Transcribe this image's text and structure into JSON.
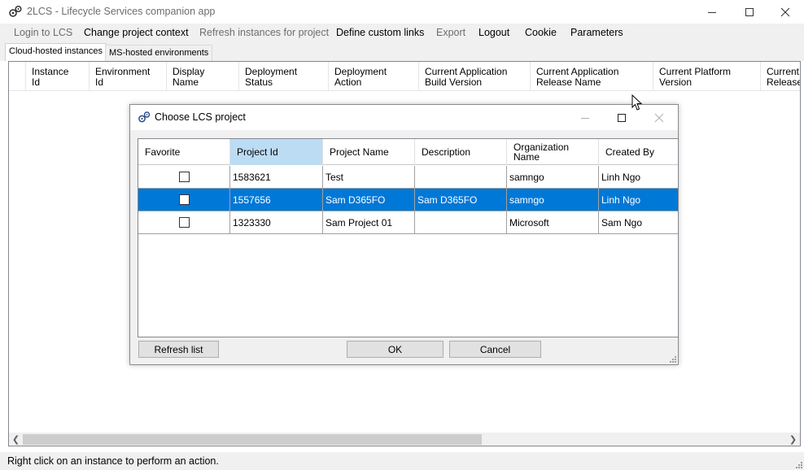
{
  "window": {
    "title": "2LCS - Lifecycle Services companion app"
  },
  "menu": [
    {
      "label": "Login to LCS",
      "enabled": false
    },
    {
      "label": "Change project context",
      "enabled": true
    },
    {
      "label": "Refresh instances for project",
      "enabled": false
    },
    {
      "label": "Define custom links",
      "enabled": true
    },
    {
      "label": "Export",
      "enabled": false
    },
    {
      "label": "Logout",
      "enabled": true
    },
    {
      "label": "Cookie",
      "enabled": true
    },
    {
      "label": "Parameters",
      "enabled": true
    }
  ],
  "tabs": [
    {
      "label": "Cloud-hosted instances",
      "active": true
    },
    {
      "label": "MS-hosted environments",
      "active": false
    }
  ],
  "instances_grid": {
    "columns": [
      [
        "Instance",
        "Id"
      ],
      [
        "Environment",
        "Id"
      ],
      [
        "Display",
        "Name"
      ],
      [
        "Deployment",
        "Status"
      ],
      [
        "Deployment",
        "Action"
      ],
      [
        "Current Application",
        "Build Version"
      ],
      [
        "Current Application",
        "Release Name"
      ],
      [
        "Current Platform",
        "Version"
      ],
      [
        "Current P",
        "Release"
      ]
    ]
  },
  "status": {
    "text": "Right click on an instance to perform an action."
  },
  "dialog": {
    "title": "Choose LCS project",
    "columns": [
      "Favorite",
      "Project Id",
      "Project Name",
      "Description",
      "Organization Name",
      "Created By"
    ],
    "column_lines": [
      [
        "Favorite"
      ],
      [
        "Project Id"
      ],
      [
        "Project Name"
      ],
      [
        "Description"
      ],
      [
        "Organization",
        "Name"
      ],
      [
        "Created By"
      ]
    ],
    "rows": [
      {
        "favorite": false,
        "project_id": "1583621",
        "project_name": "Test",
        "description": "",
        "organization": "samngo",
        "created_by": "Linh Ngo",
        "selected": false
      },
      {
        "favorite": false,
        "project_id": "1557656",
        "project_name": "Sam D365FO",
        "description": "Sam D365FO",
        "organization": "samngo",
        "created_by": "Linh Ngo",
        "selected": true
      },
      {
        "favorite": false,
        "project_id": "1323330",
        "project_name": "Sam Project 01",
        "description": "",
        "organization": "Microsoft",
        "created_by": "Sam Ngo",
        "selected": false
      }
    ],
    "buttons": {
      "refresh": "Refresh list",
      "ok": "OK",
      "cancel": "Cancel"
    }
  },
  "colors": {
    "selection": "#0078d7",
    "sorted_header": "#bcdcf4",
    "menubar": "#f0f0f0",
    "disabled_text": "#6d6d6d"
  }
}
